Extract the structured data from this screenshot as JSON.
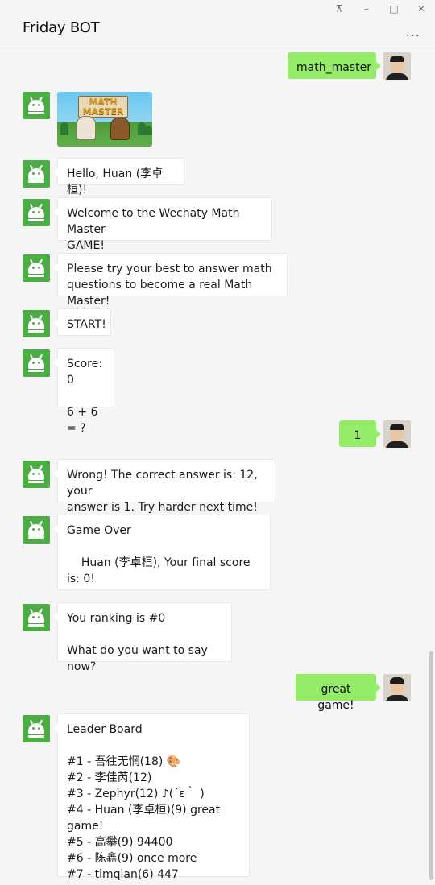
{
  "window": {
    "title": "Friday BOT",
    "controls": [
      "pin-icon",
      "minimize-icon",
      "maximize-icon",
      "close-icon"
    ],
    "more_label": "..."
  },
  "messages": {
    "m1": "math_master",
    "m2_image": {
      "line1": "MATH",
      "line2": "MASTER"
    },
    "m3": "Hello, Huan (李卓桓)!",
    "m4": "Welcome to the Wechaty Math Master\nGAME!",
    "m5": "Please try your best to answer math\nquestions to become a real Math Master!",
    "m6": "START!",
    "m7": "Score: 0\n\n6 + 6 = ?",
    "m8": "1",
    "m9": "Wrong! The correct answer is: 12, your\nanswer is 1. Try harder next time!",
    "m10": "Game Over\n\n    Huan (李卓桓), Your final score is: 0!",
    "m11": "You ranking is #0\n\nWhat do you want to say now?",
    "m12": "great game!",
    "m13": "Leader Board\n\n#1 - 吾往无惘(18) 🎨\n#2 - 李佳芮(12)\n#3 - Zephyr(12) ♪(´ε｀ )\n#4 - Huan (李卓桓)(9) great game!\n#5 - 高攀(9) 94400\n#6 - 陈鑫(9) once more\n#7 - timqian(6) 447"
  },
  "colors": {
    "bot_avatar": "#4cad46",
    "my_bubble": "#95ec69",
    "bot_bubble": "#ffffff",
    "background": "#f5f5f5"
  }
}
